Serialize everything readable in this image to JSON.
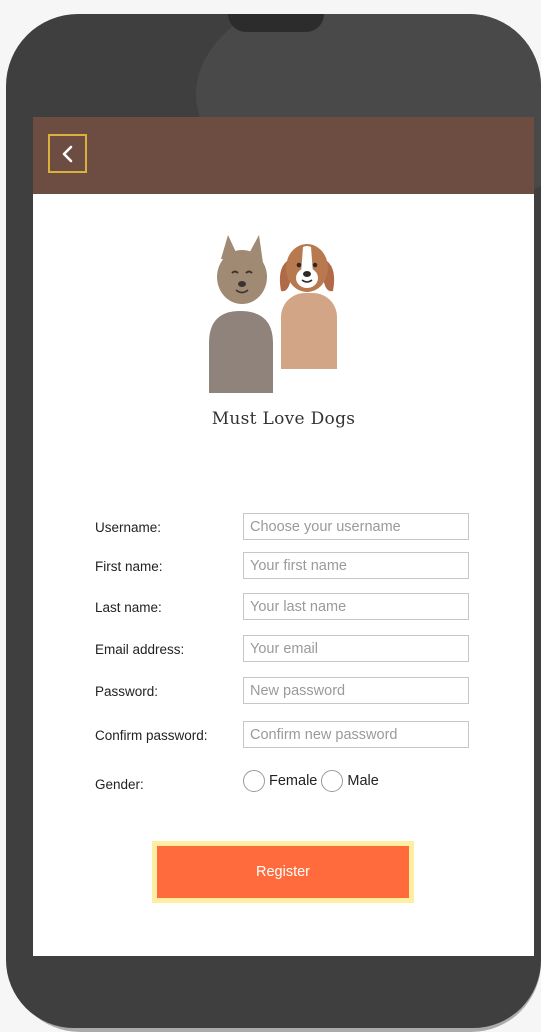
{
  "header": {
    "back_icon": "chevron-left-icon"
  },
  "brand": {
    "name": "Must Love Dogs"
  },
  "form": {
    "fields": [
      {
        "label": "Username:",
        "placeholder": "Choose your username",
        "value": ""
      },
      {
        "label": "First name:",
        "placeholder": "Your first name",
        "value": ""
      },
      {
        "label": "Last name:",
        "placeholder": "Your last name",
        "value": ""
      },
      {
        "label": "Email address:",
        "placeholder": "Your email",
        "value": ""
      },
      {
        "label": "Password:",
        "placeholder": "New password",
        "value": ""
      },
      {
        "label": "Confirm password:",
        "placeholder": "Confirm new password",
        "value": ""
      }
    ],
    "gender": {
      "label": "Gender:",
      "options": [
        "Female",
        "Male"
      ],
      "selected": ""
    },
    "register_label": "Register"
  },
  "colors": {
    "header_bg": "#6d4c41",
    "back_border": "#d9b23b",
    "register_bg": "#ff6b3d",
    "register_outline": "#fdeea2"
  }
}
